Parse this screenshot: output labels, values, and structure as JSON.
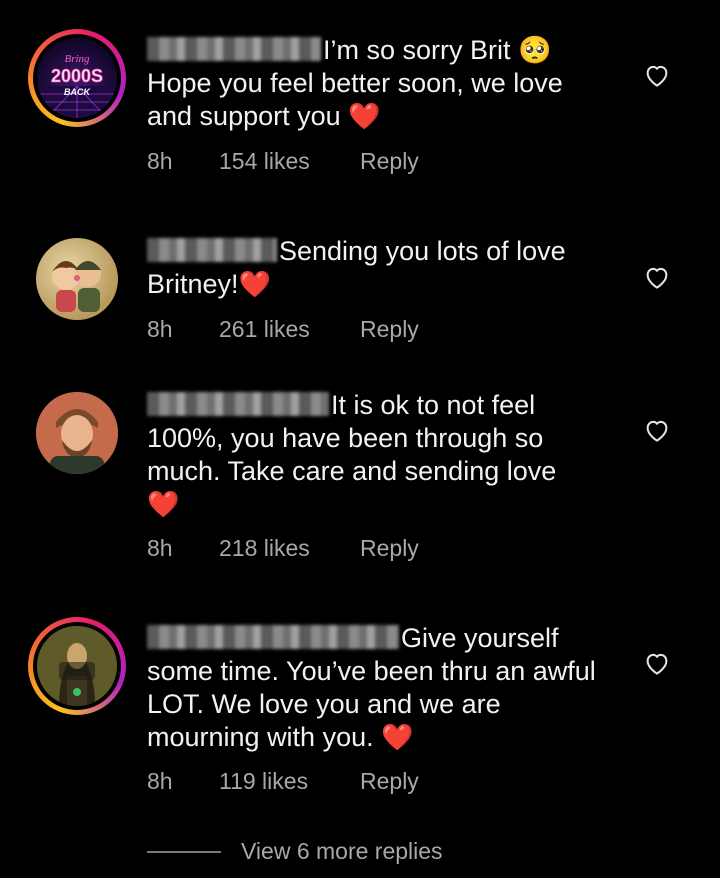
{
  "comments": [
    {
      "text": "I’m so sorry Brit 🥺 Hope you feel better soon, we love and support you",
      "time": "8h",
      "likes": "154 likes",
      "reply": "Reply",
      "avatar_text": [
        "Bring",
        "2000S",
        "BACK"
      ]
    },
    {
      "text": "Sending you lots of love Britney!",
      "time": "8h",
      "likes": "261 likes",
      "reply": "Reply"
    },
    {
      "text": "It is ok to not feel 100%, you have been through so much. Take care and sending love",
      "time": "8h",
      "likes": "218 likes",
      "reply": "Reply"
    },
    {
      "text": "Give yourself some time. You’ve been thru an awful LOT. We love you and we are mourning with you.",
      "time": "8h",
      "likes": "119 likes",
      "reply": "Reply"
    }
  ],
  "view_more": "View 6 more replies",
  "colors": {
    "background": "#000000",
    "text": "#f2f2f2",
    "meta": "#a8a8a8",
    "heart": "#f0192a"
  },
  "icons": [
    "heart-outline-icon",
    "red-heart-emoji",
    "pleading-face-emoji"
  ]
}
